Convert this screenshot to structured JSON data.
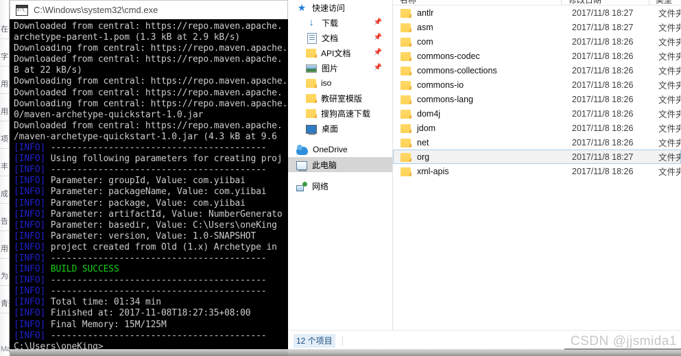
{
  "cmd_window": {
    "title": "C:\\Windows\\system32\\cmd.exe",
    "icon": "cmd-icon",
    "lines": [
      {
        "text": "Downloaded from central: https://repo.maven.apache. "
      },
      {
        "text": "archetype-parent-1.pom (1.3 kB at 2.9 kB/s)"
      },
      {
        "text": "Downloading from central: https://repo.maven.apache."
      },
      {
        "text": "Downloaded from central: https://repo.maven.apache. "
      },
      {
        "text": "B at 22 kB/s)"
      },
      {
        "text": "Downloading from central: https://repo.maven.apache."
      },
      {
        "text": "Downloaded from central: https://repo.maven.apache. "
      },
      {
        "text": "Downloading from central: https://repo.maven.apache."
      },
      {
        "text": "0/maven-archetype-quickstart-1.0.jar"
      },
      {
        "text": "Downloaded from central: https://repo.maven.apache. "
      },
      {
        "text": "/maven-archetype-quickstart-1.0.jar (4.3 kB at 9.6 "
      },
      {
        "tag": "[INFO]",
        "text": " -----------------------------------------"
      },
      {
        "tag": "[INFO]",
        "text": " Using following parameters for creating proj"
      },
      {
        "tag": "[INFO]",
        "text": " -----------------------------------------"
      },
      {
        "tag": "[INFO]",
        "text": " Parameter: groupId, Value: com.yiibai"
      },
      {
        "tag": "[INFO]",
        "text": " Parameter: packageName, Value: com.yiibai"
      },
      {
        "tag": "[INFO]",
        "text": " Parameter: package, Value: com.yiibai"
      },
      {
        "tag": "[INFO]",
        "text": " Parameter: artifactId, Value: NumberGenerato"
      },
      {
        "tag": "[INFO]",
        "text": " Parameter: basedir, Value: C:\\Users\\oneKing"
      },
      {
        "tag": "[INFO]",
        "text": " Parameter: version, Value: 1.0-SNAPSHOT"
      },
      {
        "tag": "[INFO]",
        "text": " project created from Old (1.x) Archetype in "
      },
      {
        "tag": "[INFO]",
        "text": " -----------------------------------------"
      },
      {
        "tag": "[INFO]",
        "ok": " BUILD SUCCESS"
      },
      {
        "tag": "[INFO]",
        "text": " -----------------------------------------"
      },
      {
        "tag": "[INFO]",
        "text": " -----------------------------------------"
      },
      {
        "tag": "[INFO]",
        "text": " Total time: 01:34 min"
      },
      {
        "tag": "[INFO]",
        "text": " Finished at: 2017-11-08T18:27:35+08:00"
      },
      {
        "tag": "[INFO]",
        "text": " Final Memory: 15M/125M"
      },
      {
        "tag": "[INFO]",
        "text": " -----------------------------------------"
      },
      {
        "text": ""
      },
      {
        "text": "C:\\Users\\oneKing>"
      }
    ]
  },
  "background_window": {
    "fragments": [
      "在",
      "字",
      "用",
      "用",
      "项",
      "丰",
      "成",
      "告",
      "用",
      "为",
      "青畫"
    ],
    "bottom_text": "Maven的war文件到"
  },
  "explorer": {
    "nav_pane": {
      "items": [
        {
          "label": "快速访问",
          "icon": "star-pin-icon",
          "indent": 0,
          "pinned": false,
          "selected": false
        },
        {
          "label": "下载",
          "icon": "download-icon",
          "indent": 1,
          "pinned": true,
          "selected": false
        },
        {
          "label": "文档",
          "icon": "documents-icon",
          "indent": 1,
          "pinned": true,
          "selected": false
        },
        {
          "label": "API文档",
          "icon": "folder-icon",
          "indent": 1,
          "pinned": true,
          "selected": false
        },
        {
          "label": "图片",
          "icon": "pictures-icon",
          "indent": 1,
          "pinned": true,
          "selected": false
        },
        {
          "label": "iso",
          "icon": "folder-icon",
          "indent": 1,
          "pinned": false,
          "selected": false
        },
        {
          "label": "教研室模版",
          "icon": "folder-icon",
          "indent": 1,
          "pinned": false,
          "selected": false
        },
        {
          "label": "搜狗高速下载",
          "icon": "folder-icon",
          "indent": 1,
          "pinned": false,
          "selected": false
        },
        {
          "label": "桌面",
          "icon": "desktop-icon",
          "indent": 1,
          "pinned": false,
          "selected": false
        },
        {
          "label": "OneDrive",
          "icon": "onedrive-icon",
          "indent": 0,
          "pinned": false,
          "selected": false
        },
        {
          "label": "此电脑",
          "icon": "this-pc-icon",
          "indent": 0,
          "pinned": false,
          "selected": true
        },
        {
          "label": "网络",
          "icon": "network-icon",
          "indent": 0,
          "pinned": false,
          "selected": false
        }
      ]
    },
    "columns": {
      "name": "名称",
      "date": "修改日期",
      "type": "类型"
    },
    "files": [
      {
        "name": "antlr",
        "date": "2017/11/8 18:27",
        "type": "文件夹",
        "selected": false
      },
      {
        "name": "asm",
        "date": "2017/11/8 18:27",
        "type": "文件夹",
        "selected": false
      },
      {
        "name": "com",
        "date": "2017/11/8 18:26",
        "type": "文件夹",
        "selected": false
      },
      {
        "name": "commons-codec",
        "date": "2017/11/8 18:26",
        "type": "文件夹",
        "selected": false
      },
      {
        "name": "commons-collections",
        "date": "2017/11/8 18:26",
        "type": "文件夹",
        "selected": false
      },
      {
        "name": "commons-io",
        "date": "2017/11/8 18:26",
        "type": "文件夹",
        "selected": false
      },
      {
        "name": "commons-lang",
        "date": "2017/11/8 18:26",
        "type": "文件夹",
        "selected": false
      },
      {
        "name": "dom4j",
        "date": "2017/11/8 18:26",
        "type": "文件夹",
        "selected": false
      },
      {
        "name": "jdom",
        "date": "2017/11/8 18:26",
        "type": "文件夹",
        "selected": false
      },
      {
        "name": "net",
        "date": "2017/11/8 18:26",
        "type": "文件夹",
        "selected": false
      },
      {
        "name": "org",
        "date": "2017/11/8 18:27",
        "type": "文件夹",
        "selected": true
      },
      {
        "name": "xml-apis",
        "date": "2017/11/8 18:26",
        "type": "文件夹",
        "selected": false
      }
    ],
    "status_bar": {
      "item_count": "12 个项目"
    }
  },
  "watermark": {
    "text": "CSDN @jjsmida1"
  },
  "colors": {
    "terminal_bg": "#000000",
    "terminal_fg": "#cccccc",
    "info_tag": "#2020d0",
    "build_success": "#13d013",
    "folder_yellow": "#ffd257",
    "selection_border": "#a8cfec",
    "nav_selected": "#d6d6d6",
    "status_count_fg": "#1a4d80"
  }
}
